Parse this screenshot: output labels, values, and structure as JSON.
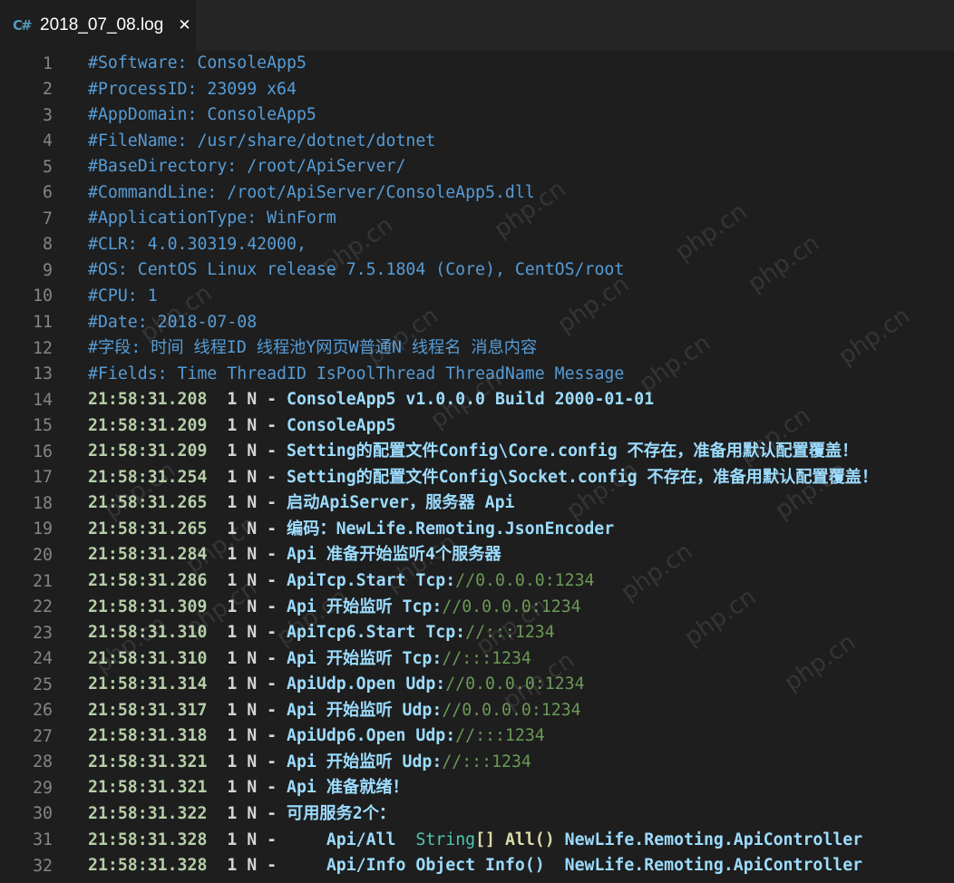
{
  "tab": {
    "icon": "csharp-icon",
    "icon_glyph": "C#",
    "title": "2018_07_08.log",
    "close_glyph": "✕"
  },
  "lines": [
    {
      "num": "1",
      "text": "#Software: ConsoleApp5"
    },
    {
      "num": "2",
      "text": "#ProcessID: 23099 x64"
    },
    {
      "num": "3",
      "text": "#AppDomain: ConsoleApp5"
    },
    {
      "num": "4",
      "text": "#FileName: /usr/share/dotnet/dotnet"
    },
    {
      "num": "5",
      "text": "#BaseDirectory: /root/ApiServer/"
    },
    {
      "num": "6",
      "text": "#CommandLine: /root/ApiServer/ConsoleApp5.dll"
    },
    {
      "num": "7",
      "text": "#ApplicationType: WinForm"
    },
    {
      "num": "8",
      "text": "#CLR: 4.0.30319.42000,"
    },
    {
      "num": "9",
      "text": "#OS: CentOS Linux release 7.5.1804 (Core), CentOS/root"
    },
    {
      "num": "10",
      "text": "#CPU: 1"
    },
    {
      "num": "11",
      "text": "#Date: 2018-07-08"
    },
    {
      "num": "12",
      "text": "#字段: 时间 线程ID 线程池Y网页W普通N 线程名 消息内容"
    },
    {
      "num": "13",
      "text": "#Fields: Time ThreadID IsPoolThread ThreadName Message"
    },
    {
      "num": "14",
      "time": "21:58:31.208",
      "thread": "1 N -",
      "msg": "ConsoleApp5 v1.0.0.0 Build 2000-01-01"
    },
    {
      "num": "15",
      "time": "21:58:31.209",
      "thread": "1 N -",
      "msg": "ConsoleApp5"
    },
    {
      "num": "16",
      "time": "21:58:31.209",
      "thread": "1 N -",
      "msg": "Setting的配置文件Config\\Core.config 不存在，准备用默认配置覆盖！"
    },
    {
      "num": "17",
      "time": "21:58:31.254",
      "thread": "1 N -",
      "msg": "Setting的配置文件Config\\Socket.config 不存在，准备用默认配置覆盖！"
    },
    {
      "num": "18",
      "time": "21:58:31.265",
      "thread": "1 N -",
      "msg": "启动ApiServer，服务器 Api"
    },
    {
      "num": "19",
      "time": "21:58:31.265",
      "thread": "1 N -",
      "msg": "编码：NewLife.Remoting.JsonEncoder"
    },
    {
      "num": "20",
      "time": "21:58:31.284",
      "thread": "1 N -",
      "msg": "Api 准备开始监听4个服务器"
    },
    {
      "num": "21",
      "time": "21:58:31.286",
      "thread": "1 N -",
      "msg": "ApiTcp.Start Tcp:",
      "comment": "//0.0.0.0:1234"
    },
    {
      "num": "22",
      "time": "21:58:31.309",
      "thread": "1 N -",
      "msg": "Api 开始监听 Tcp:",
      "comment": "//0.0.0.0:1234"
    },
    {
      "num": "23",
      "time": "21:58:31.310",
      "thread": "1 N -",
      "msg": "ApiTcp6.Start Tcp:",
      "comment": "//:::1234"
    },
    {
      "num": "24",
      "time": "21:58:31.310",
      "thread": "1 N -",
      "msg": "Api 开始监听 Tcp:",
      "comment": "//:::1234"
    },
    {
      "num": "25",
      "time": "21:58:31.314",
      "thread": "1 N -",
      "msg": "ApiUdp.Open Udp:",
      "comment": "//0.0.0.0:1234"
    },
    {
      "num": "26",
      "time": "21:58:31.317",
      "thread": "1 N -",
      "msg": "Api 开始监听 Udp:",
      "comment": "//0.0.0.0:1234"
    },
    {
      "num": "27",
      "time": "21:58:31.318",
      "thread": "1 N -",
      "msg": "ApiUdp6.Open Udp:",
      "comment": "//:::1234"
    },
    {
      "num": "28",
      "time": "21:58:31.321",
      "thread": "1 N -",
      "msg": "Api 开始监听 Udp:",
      "comment": "//:::1234"
    },
    {
      "num": "29",
      "time": "21:58:31.321",
      "thread": "1 N -",
      "msg": "Api 准备就绪！"
    },
    {
      "num": "30",
      "time": "21:58:31.322",
      "thread": "1 N -",
      "msg": "可用服务2个："
    },
    {
      "num": "31",
      "time": "21:58:31.328",
      "thread": "1 N -",
      "indent": "    ",
      "msg_a": "Api/All  ",
      "type": "String",
      "msg_b": "[] All()",
      "msg_c": " NewLife.Remoting.ApiController"
    },
    {
      "num": "32",
      "time": "21:58:31.328",
      "thread": "1 N -",
      "indent": "    ",
      "msg_a": "Api/Info Object Info()",
      "msg_c": "  NewLife.Remoting.ApiController"
    }
  ],
  "watermark": "php.cn"
}
